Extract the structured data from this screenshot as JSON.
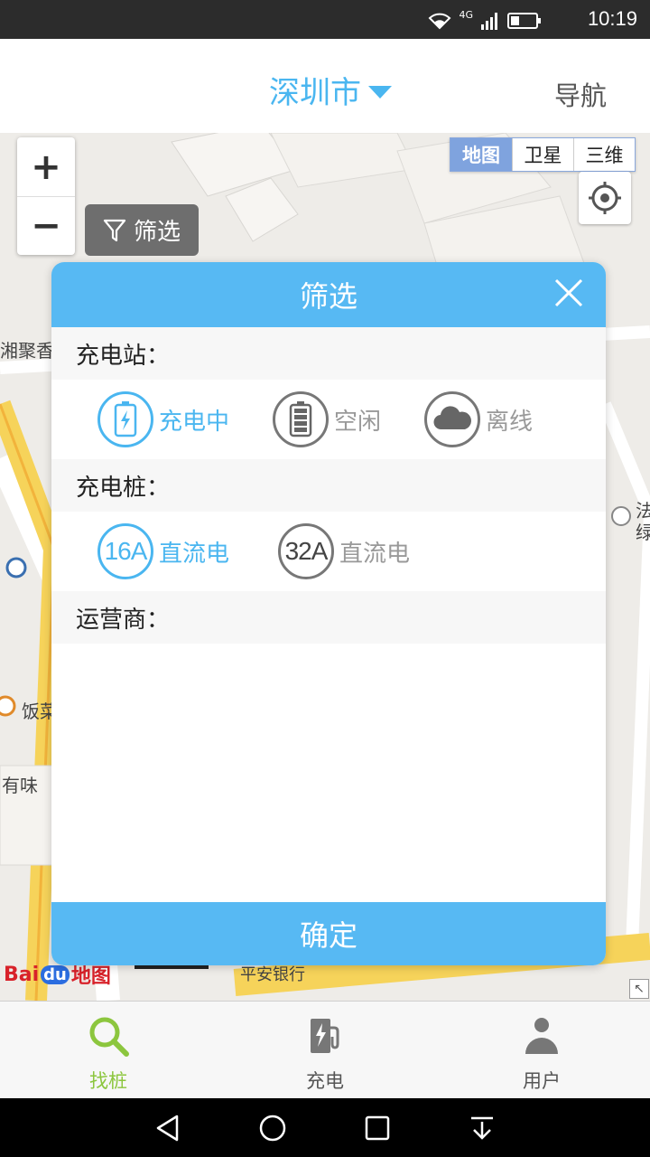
{
  "status_bar": {
    "time": "10:19",
    "network": "4G"
  },
  "header": {
    "city": "深圳市",
    "nav_label": "导航"
  },
  "map": {
    "zoom_in": "+",
    "zoom_out": "−",
    "filter_label": "筛选",
    "map_types": [
      "地图",
      "卫星",
      "三维"
    ],
    "labels": [
      "湘聚香",
      "饭菜",
      "有味",
      "法",
      "绿"
    ],
    "bank_label": "平安银行",
    "logo_text": "Bai",
    "logo_du": "du",
    "logo_suffix": "地图"
  },
  "filter_modal": {
    "title": "筛选",
    "station_section": "充电站：",
    "station_options": [
      "充电中",
      "空闲",
      "离线"
    ],
    "pile_section": "充电桩：",
    "pile_options": [
      {
        "badge": "16A",
        "label": "直流电"
      },
      {
        "badge": "32A",
        "label": "直流电"
      }
    ],
    "operator_section": "运营商：",
    "confirm_label": "确定"
  },
  "tabbar": {
    "tabs": [
      "找桩",
      "充电",
      "用户"
    ]
  },
  "colors": {
    "accent": "#57b9f3",
    "tab_active": "#8cc63e"
  }
}
